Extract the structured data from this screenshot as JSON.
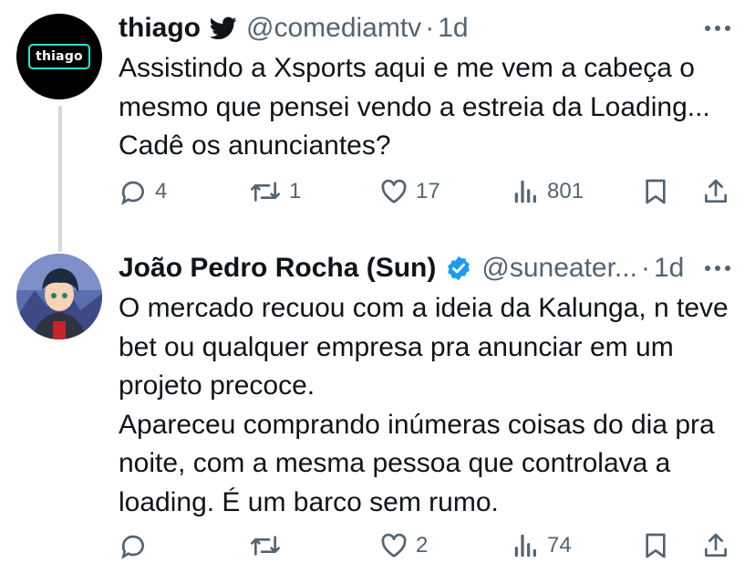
{
  "tweets": [
    {
      "avatar_text": "thiago",
      "name": "thiago",
      "handle": "@comediamtv",
      "dot": "·",
      "time": "1d",
      "text": "Assistindo a Xsports aqui e me vem a cabeça o mesmo que pensei vendo a estreia da Loading... Cadê os anunciantes?",
      "counts": {
        "replies": "4",
        "retweets": "1",
        "likes": "17",
        "views": "801"
      }
    },
    {
      "name": "João Pedro Rocha (Sun)",
      "handle": "@suneater...",
      "dot": "·",
      "time": "1d",
      "text": "O mercado recuou com a ideia da Kalunga, n teve bet ou qualquer empresa pra anunciar em um projeto precoce.\nApareceu comprando inúmeras coisas do dia pra noite, com a mesma pessoa que controlava a loading. É um barco sem rumo.",
      "counts": {
        "replies": "",
        "retweets": "",
        "likes": "2",
        "views": "74"
      }
    }
  ],
  "colors": {
    "text": "#0f1419",
    "muted": "#536471",
    "verified": "#1d9bf0",
    "line": "#cfd9de"
  },
  "icons": [
    "twitter-bird-icon",
    "verified-badge-icon",
    "more-icon",
    "reply-icon",
    "retweet-icon",
    "like-icon",
    "views-icon",
    "bookmark-icon",
    "share-icon"
  ]
}
